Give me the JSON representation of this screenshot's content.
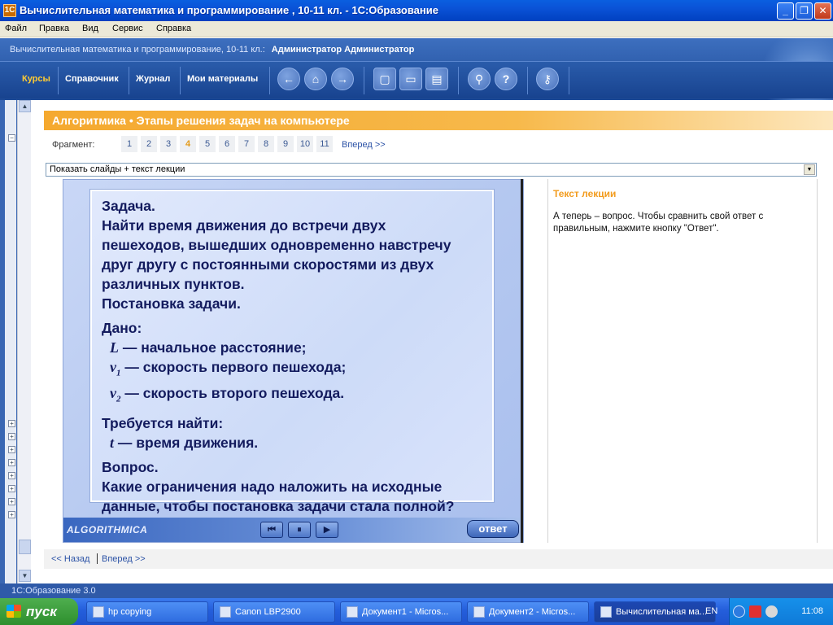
{
  "window": {
    "title": "Вычислительная математика и программирование , 10-11 кл. - 1С:Образование"
  },
  "menu": [
    "Файл",
    "Правка",
    "Вид",
    "Сервис",
    "Справка"
  ],
  "header": {
    "course": "Вычислительная математика и программирование, 10-11 кл.:",
    "user": "Администратор Администратор",
    "tabs": [
      "Курсы",
      "Справочник",
      "Журнал",
      "Мои материалы"
    ],
    "active_tab": "Курсы",
    "icons": [
      "back-arrow-icon",
      "home-icon",
      "forward-arrow-icon",
      "fullscreen-icon",
      "presentation-icon",
      "print-icon",
      "search-icon",
      "help-icon",
      "magnify-key-icon"
    ]
  },
  "content": {
    "title": "Алгоритмика • Этапы решения задач на компьютере",
    "fragment_label": "Фрагмент:",
    "fragments": [
      "1",
      "2",
      "3",
      "4",
      "5",
      "6",
      "7",
      "8",
      "9",
      "10",
      "11"
    ],
    "current_fragment": "4",
    "forward_link": "Вперед >>",
    "view_mode": "Показать слайды + текст лекции"
  },
  "slide": {
    "lines": {
      "l1": "Задача.",
      "l2": "Найти время движения до встречи двух",
      "l3": "пешеходов, вышедших одновременно навстречу",
      "l4": "друг другу с постоянными скоростями из двух",
      "l5": "различных пунктов.",
      "l6": "Постановка задачи.",
      "l7": "Дано:",
      "l8_sym": "L",
      "l8": " — начальное расстояние;",
      "l9_sym": "v",
      "l9_sub": "1",
      "l9": " — скорость первого пешехода;",
      "l10_sym": "v",
      "l10_sub": "2",
      "l10": " — скорость второго пешехода.",
      "l11": "Требуется найти:",
      "l12_sym": "t",
      "l12": " — время движения.",
      "l13": "Вопрос.",
      "l14": "Какие ограничения надо наложить на исходные",
      "l15": "данные, чтобы постановка задачи стала полной?"
    },
    "brand": "ALGORITHMICA",
    "answer_label": "ответ"
  },
  "lecture": {
    "heading": "Текст лекции",
    "text": "А теперь – вопрос. Чтобы сравнить свой ответ с правильным, нажмите кнопку \"Ответ\"."
  },
  "bottom_nav": {
    "back": "<< Назад",
    "forward": "Вперед >>"
  },
  "status": "1С:Образование 3.0",
  "taskbar": {
    "start": "пуск",
    "tasks": [
      "hp copying",
      "Canon LBP2900",
      "Документ1 - Micros...",
      "Документ2 - Micros...",
      "Вычислительная ма..."
    ],
    "lang": "EN",
    "clock": "11:08"
  },
  "colors": {
    "accent_orange": "#f5a92f",
    "nav_blue": "#1d4a96",
    "slide_text": "#131b5e"
  }
}
